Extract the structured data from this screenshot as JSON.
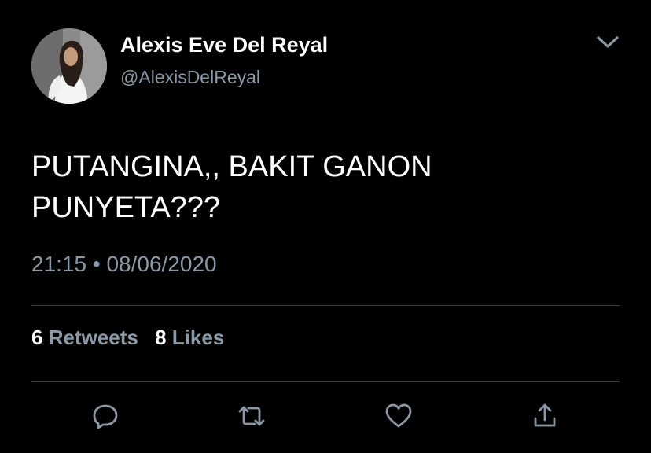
{
  "tweet": {
    "author": {
      "display_name": "Alexis Eve Del Reyal",
      "handle": "@AlexisDelReyal",
      "avatar_icon": "profile-photo"
    },
    "text_lines": [
      "PUTANGINA,, BAKIT GANON",
      "PUNYETA???"
    ],
    "time": "21:15",
    "separator": "•",
    "date": "08/06/2020",
    "stats": {
      "retweets_count": "6",
      "retweets_label": "Retweets",
      "likes_count": "8",
      "likes_label": "Likes"
    },
    "actions": [
      "reply-icon",
      "retweet-icon",
      "like-icon",
      "share-icon"
    ]
  },
  "colors": {
    "background": "#000000",
    "primary_text": "#ffffff",
    "secondary_text": "#8b98a5",
    "divider": "#3a3f44"
  }
}
